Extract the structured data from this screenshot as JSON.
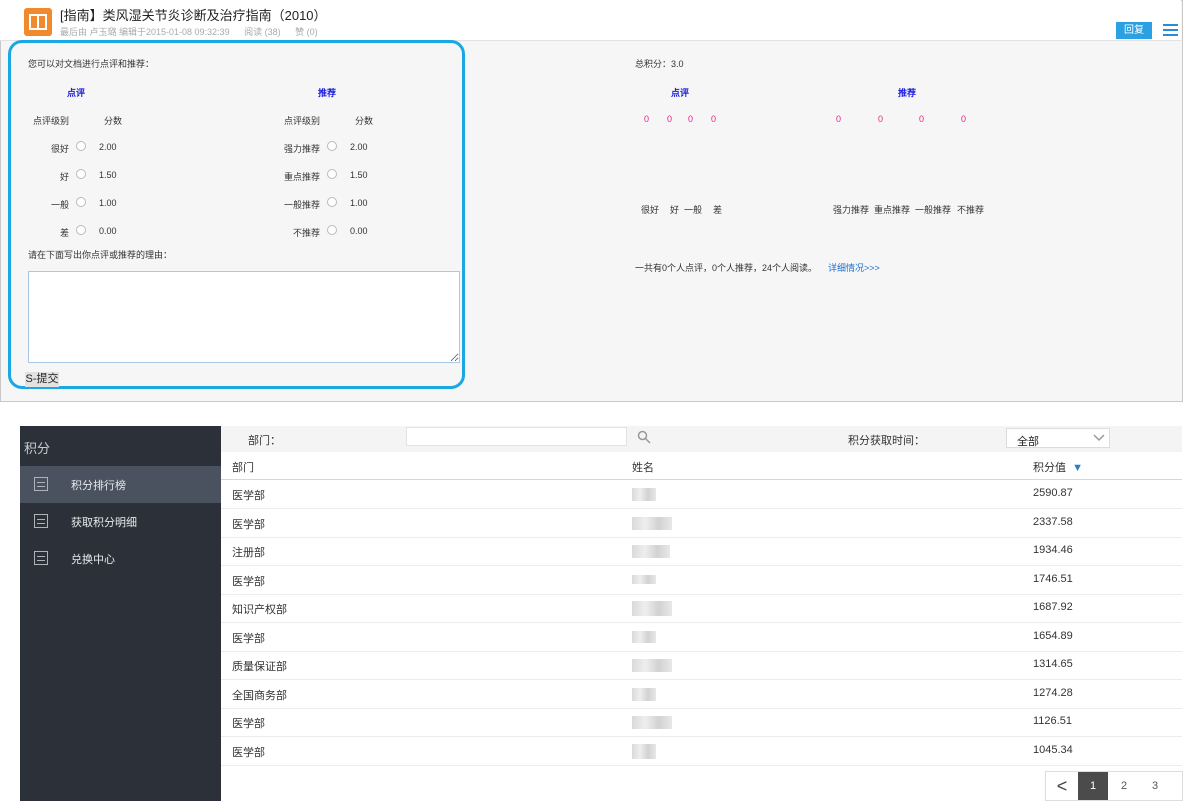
{
  "doc": {
    "title": "[指南】类风湿关节炎诊断及治疗指南（2010）",
    "meta_author": "最后由 卢玉璐 编辑于2015-01-08 09:32:39",
    "meta_read": "阅读 (38)",
    "meta_like": "赞 (0)",
    "reply_label": "回复",
    "icon": "book-icon",
    "accent_color": "#f08a2c"
  },
  "review": {
    "intro": "您可以对文档进行点评和推荐：",
    "comment_header": "点评",
    "recommend_header": "推荐",
    "level_col": "点评级别",
    "score_col": "分数",
    "rec_level_col": "点评级别",
    "rec_score_col": "分数",
    "comment_options": [
      {
        "label": "很好",
        "score": "2.00"
      },
      {
        "label": "好",
        "score": "1.50"
      },
      {
        "label": "一般",
        "score": "1.00"
      },
      {
        "label": "差",
        "score": "0.00"
      }
    ],
    "recommend_options": [
      {
        "label": "强力推荐",
        "score": "2.00"
      },
      {
        "label": "重点推荐",
        "score": "1.50"
      },
      {
        "label": "一般推荐",
        "score": "1.00"
      },
      {
        "label": "不推荐",
        "score": "0.00"
      }
    ],
    "reason_prompt": "请在下面写出你点评或推荐的理由：",
    "submit_label": "S-提交",
    "highlight_color": "#19a8e4"
  },
  "summary": {
    "total_score": "总积分：3.0",
    "comment_header": "点评",
    "recommend_header": "推荐",
    "comment_counts": [
      "0",
      "0",
      "0",
      "0"
    ],
    "recommend_counts": [
      "0",
      "0",
      "0",
      "0"
    ],
    "comment_labels": [
      "很好",
      "好",
      "一般",
      "差"
    ],
    "recommend_labels": [
      "强力推荐",
      "重点推荐",
      "一般推荐",
      "不推荐"
    ],
    "stats_text": "一共有0个人点评，0个人推荐，24个人阅读。",
    "details_link": "详细情况>>>"
  },
  "sidebar": {
    "title": "积分",
    "items": [
      {
        "label": "积分排行榜",
        "active": true
      },
      {
        "label": "获取积分明细",
        "active": false
      },
      {
        "label": "兑换中心",
        "active": false
      }
    ]
  },
  "filters": {
    "dept_label": "部门：",
    "time_label": "积分获取时间：",
    "time_value": "全部"
  },
  "table": {
    "columns": [
      "部门",
      "姓名",
      "积分值"
    ],
    "sort_indicator": "▼",
    "rows": [
      {
        "dept": "医学部",
        "score": "2590.87"
      },
      {
        "dept": "医学部",
        "score": "2337.58"
      },
      {
        "dept": "注册部",
        "score": "1934.46"
      },
      {
        "dept": "医学部",
        "score": "1746.51"
      },
      {
        "dept": "知识产权部",
        "score": "1687.92"
      },
      {
        "dept": "医学部",
        "score": "1654.89"
      },
      {
        "dept": "质量保证部",
        "score": "1314.65"
      },
      {
        "dept": "全国商务部",
        "score": "1274.28"
      },
      {
        "dept": "医学部",
        "score": "1126.51"
      },
      {
        "dept": "医学部",
        "score": "1045.34"
      }
    ]
  },
  "pagination": {
    "prev": "<",
    "pages": [
      "1",
      "2",
      "3"
    ],
    "current": "1"
  }
}
